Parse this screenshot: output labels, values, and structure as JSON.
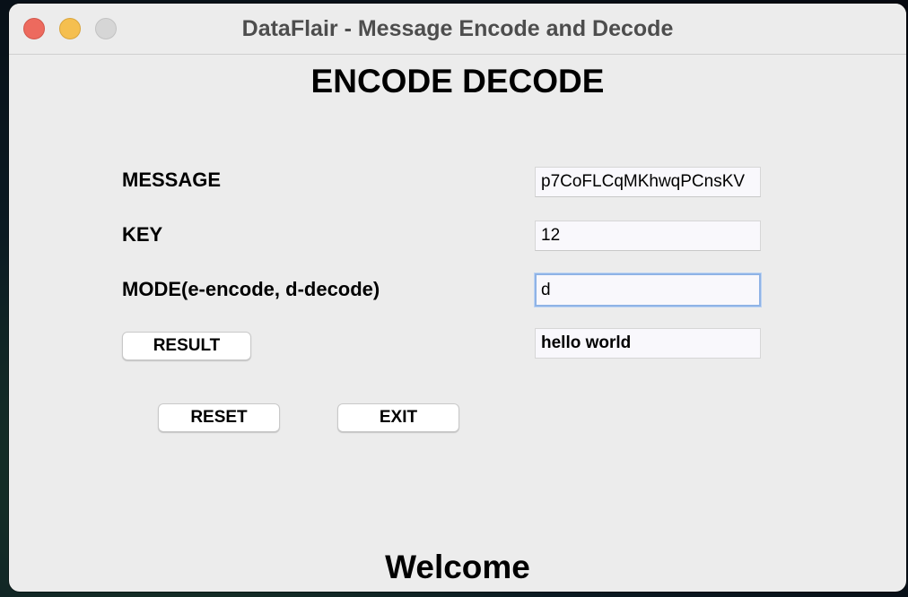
{
  "window": {
    "title": "DataFlair - Message Encode and Decode"
  },
  "header": {
    "title": "ENCODE DECODE"
  },
  "form": {
    "message_label": "MESSAGE",
    "message_value": "p7CoFLCqMKhwqPCnsKV",
    "key_label": "KEY",
    "key_value": "12",
    "mode_label": "MODE(e-encode, d-decode)",
    "mode_value": "d",
    "result_button": "RESULT",
    "result_value": "hello world"
  },
  "actions": {
    "reset_label": "RESET",
    "exit_label": "EXIT"
  },
  "footer": {
    "text": "Welcome"
  },
  "colors": {
    "window_bg": "#ececec",
    "close": "#ed6a5e",
    "minimize": "#f5bf4f",
    "maximize": "#d6d6d6",
    "focus_ring": "#8fb3e6"
  }
}
